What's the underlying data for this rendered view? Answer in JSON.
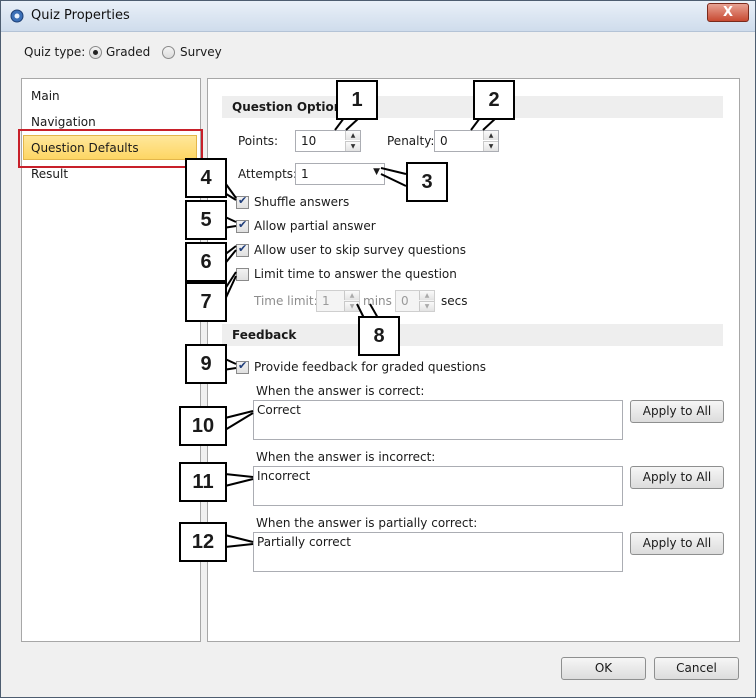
{
  "window": {
    "title": "Quiz Properties",
    "close_label": "X"
  },
  "quiz_type": {
    "label": "Quiz type:",
    "options": [
      "Graded",
      "Survey"
    ],
    "selected": "Graded"
  },
  "nav": {
    "items": [
      "Main",
      "Navigation",
      "Question Defaults",
      "Result"
    ],
    "selected": "Question Defaults"
  },
  "question_options": {
    "header": "Question Options",
    "points_label": "Points:",
    "points_value": "10",
    "penalty_label": "Penalty:",
    "penalty_value": "0",
    "attempts_label": "Attempts:",
    "attempts_value": "1",
    "shuffle_label": "Shuffle answers",
    "shuffle_checked": true,
    "partial_label": "Allow partial answer",
    "partial_checked": true,
    "skip_label": "Allow user to skip survey questions",
    "skip_checked": true,
    "limit_label": "Limit time to answer the question",
    "limit_checked": false,
    "time_limit_label": "Time limit:",
    "mins_value": "1",
    "mins_label": "mins",
    "secs_value": "0",
    "secs_label": "secs"
  },
  "feedback": {
    "header": "Feedback",
    "provide_label": "Provide feedback for graded questions",
    "provide_checked": true,
    "correct_label": "When the answer is correct:",
    "correct_value": "Correct",
    "incorrect_label": "When the answer is incorrect:",
    "incorrect_value": "Incorrect",
    "partial_label": "When the answer is partially correct:",
    "partial_value": "Partially correct",
    "apply_label": "Apply to All"
  },
  "footer": {
    "ok_label": "OK",
    "cancel_label": "Cancel"
  },
  "callouts": [
    "1",
    "2",
    "3",
    "4",
    "5",
    "6",
    "7",
    "8",
    "9",
    "10",
    "11",
    "12"
  ],
  "colors": {
    "nav_highlight": "#fdd664",
    "callout_border": "#000000",
    "selection_outline": "#c8202a"
  }
}
